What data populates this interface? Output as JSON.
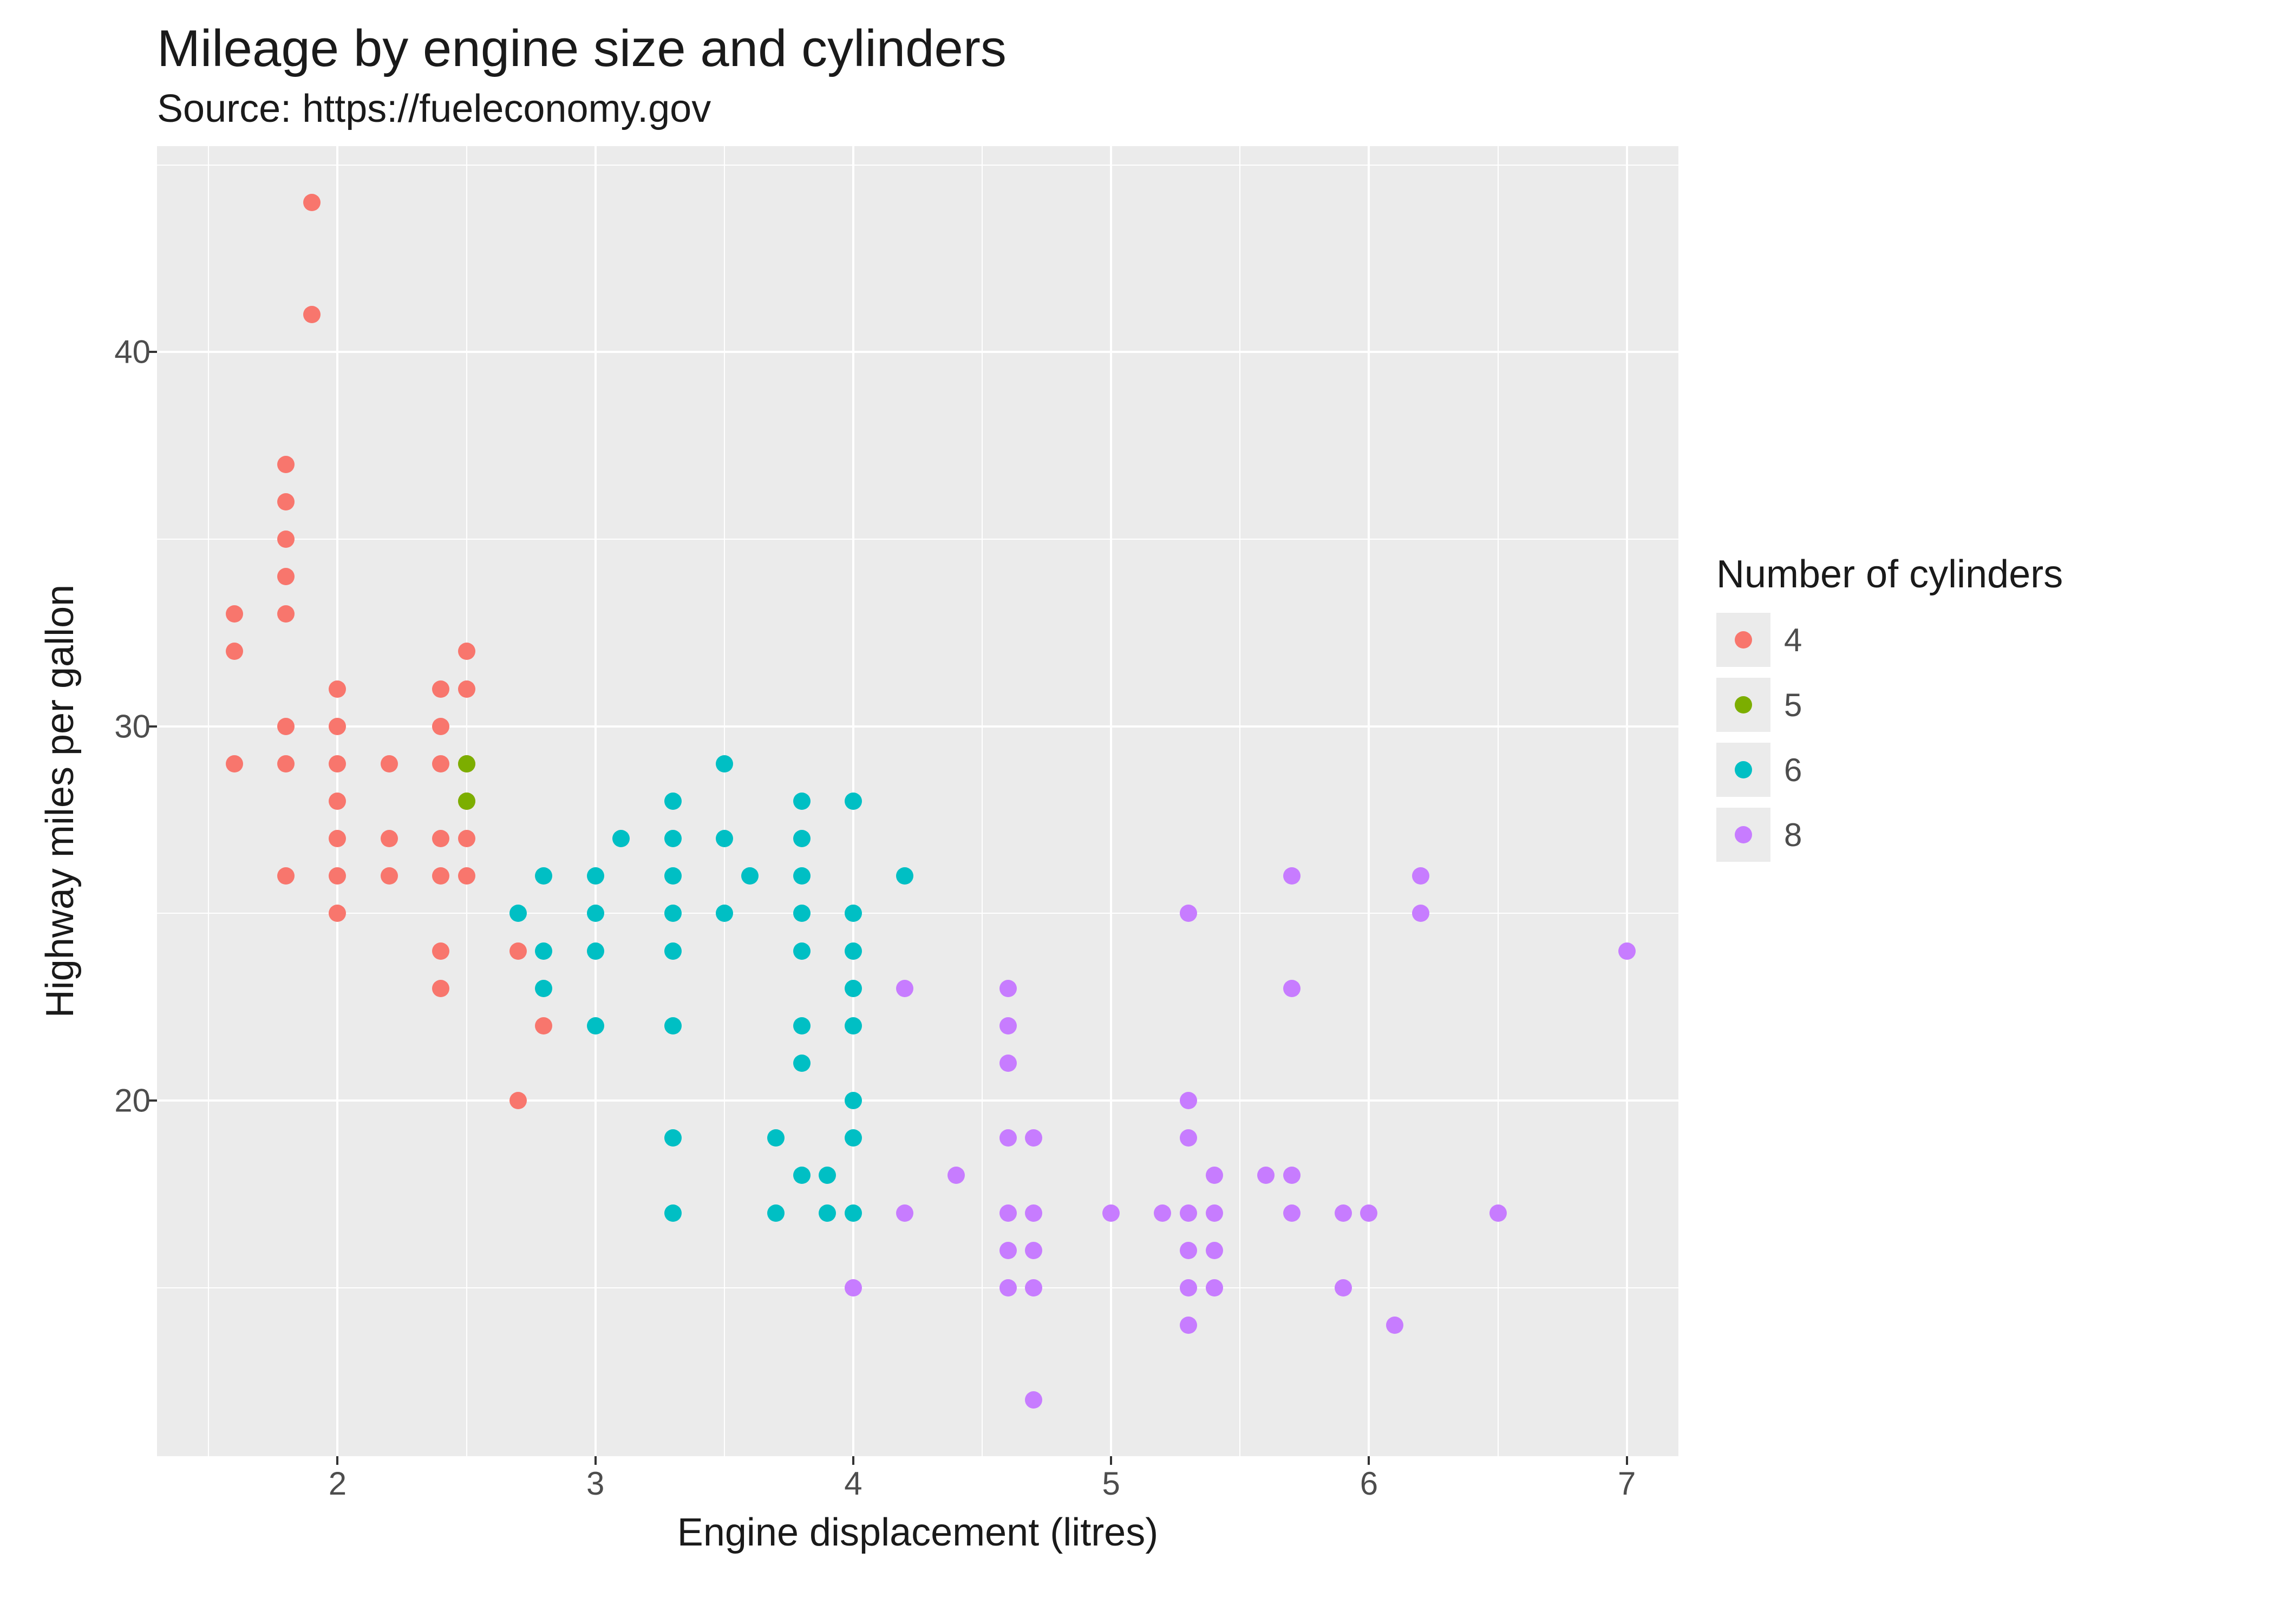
{
  "title": "Mileage by engine size and cylinders",
  "subtitle": "Source: https://fueleconomy.gov",
  "xlabel": "Engine displacement (litres)",
  "ylabel": "Highway miles per gallon",
  "legend_title": "Number of cylinders",
  "legend_items": [
    {
      "label": "4",
      "color": "#F8766D"
    },
    {
      "label": "5",
      "color": "#7CAE00"
    },
    {
      "label": "6",
      "color": "#00BFC4"
    },
    {
      "label": "8",
      "color": "#C77CFF"
    }
  ],
  "x_ticks": [
    2,
    3,
    4,
    5,
    6,
    7
  ],
  "y_ticks": [
    20,
    30,
    40
  ],
  "x_tick_labels": [
    "2",
    "3",
    "4",
    "5",
    "6",
    "7"
  ],
  "y_tick_labels": [
    "20",
    "30",
    "40"
  ],
  "chart_data": {
    "type": "scatter",
    "title": "Mileage by engine size and cylinders",
    "subtitle": "Source: https://fueleconomy.gov",
    "xlabel": "Engine displacement (litres)",
    "ylabel": "Highway miles per gallon",
    "xlim": [
      1.3,
      7.2
    ],
    "ylim": [
      10.5,
      45.5
    ],
    "legend_title": "Number of cylinders",
    "series": [
      {
        "name": "4",
        "color": "#F8766D",
        "points": [
          [
            1.6,
            29
          ],
          [
            1.6,
            32
          ],
          [
            1.6,
            33
          ],
          [
            1.8,
            26
          ],
          [
            1.8,
            29
          ],
          [
            1.8,
            30
          ],
          [
            1.8,
            33
          ],
          [
            1.8,
            34
          ],
          [
            1.8,
            35
          ],
          [
            1.8,
            36
          ],
          [
            1.8,
            37
          ],
          [
            1.9,
            41
          ],
          [
            1.9,
            44
          ],
          [
            2.0,
            25
          ],
          [
            2.0,
            26
          ],
          [
            2.0,
            27
          ],
          [
            2.0,
            28
          ],
          [
            2.0,
            29
          ],
          [
            2.0,
            30
          ],
          [
            2.0,
            31
          ],
          [
            2.2,
            26
          ],
          [
            2.2,
            27
          ],
          [
            2.2,
            29
          ],
          [
            2.4,
            23
          ],
          [
            2.4,
            24
          ],
          [
            2.4,
            26
          ],
          [
            2.4,
            27
          ],
          [
            2.4,
            29
          ],
          [
            2.4,
            30
          ],
          [
            2.4,
            31
          ],
          [
            2.5,
            26
          ],
          [
            2.5,
            27
          ],
          [
            2.5,
            28
          ],
          [
            2.5,
            29
          ],
          [
            2.5,
            31
          ],
          [
            2.5,
            32
          ],
          [
            2.7,
            24
          ],
          [
            2.8,
            22
          ],
          [
            2.7,
            20
          ]
        ]
      },
      {
        "name": "5",
        "color": "#7CAE00",
        "points": [
          [
            2.5,
            28
          ],
          [
            2.5,
            29
          ]
        ]
      },
      {
        "name": "6",
        "color": "#00BFC4",
        "points": [
          [
            2.7,
            25
          ],
          [
            2.8,
            23
          ],
          [
            2.8,
            24
          ],
          [
            2.8,
            26
          ],
          [
            3.0,
            22
          ],
          [
            3.0,
            24
          ],
          [
            3.0,
            25
          ],
          [
            3.0,
            26
          ],
          [
            3.1,
            27
          ],
          [
            3.3,
            17
          ],
          [
            3.3,
            19
          ],
          [
            3.3,
            22
          ],
          [
            3.3,
            24
          ],
          [
            3.3,
            25
          ],
          [
            3.3,
            26
          ],
          [
            3.3,
            27
          ],
          [
            3.3,
            28
          ],
          [
            3.5,
            25
          ],
          [
            3.5,
            27
          ],
          [
            3.5,
            29
          ],
          [
            3.6,
            26
          ],
          [
            3.7,
            17
          ],
          [
            3.7,
            19
          ],
          [
            3.8,
            18
          ],
          [
            3.8,
            21
          ],
          [
            3.8,
            22
          ],
          [
            3.8,
            24
          ],
          [
            3.8,
            25
          ],
          [
            3.8,
            26
          ],
          [
            3.8,
            27
          ],
          [
            3.8,
            28
          ],
          [
            3.9,
            17
          ],
          [
            3.9,
            18
          ],
          [
            4.0,
            17
          ],
          [
            4.0,
            19
          ],
          [
            4.0,
            20
          ],
          [
            4.0,
            22
          ],
          [
            4.0,
            23
          ],
          [
            4.0,
            24
          ],
          [
            4.0,
            25
          ],
          [
            4.2,
            26
          ],
          [
            4.0,
            28
          ]
        ]
      },
      {
        "name": "8",
        "color": "#C77CFF",
        "points": [
          [
            4.0,
            15
          ],
          [
            4.2,
            17
          ],
          [
            4.2,
            23
          ],
          [
            4.4,
            18
          ],
          [
            4.6,
            15
          ],
          [
            4.6,
            16
          ],
          [
            4.6,
            17
          ],
          [
            4.6,
            19
          ],
          [
            4.6,
            21
          ],
          [
            4.6,
            22
          ],
          [
            4.6,
            23
          ],
          [
            4.7,
            12
          ],
          [
            4.7,
            15
          ],
          [
            4.7,
            16
          ],
          [
            4.7,
            17
          ],
          [
            4.7,
            19
          ],
          [
            5.0,
            17
          ],
          [
            5.2,
            17
          ],
          [
            5.3,
            14
          ],
          [
            5.3,
            15
          ],
          [
            5.3,
            16
          ],
          [
            5.3,
            17
          ],
          [
            5.3,
            19
          ],
          [
            5.3,
            20
          ],
          [
            5.3,
            25
          ],
          [
            5.4,
            15
          ],
          [
            5.4,
            16
          ],
          [
            5.4,
            17
          ],
          [
            5.4,
            18
          ],
          [
            5.6,
            18
          ],
          [
            5.7,
            17
          ],
          [
            5.7,
            18
          ],
          [
            5.7,
            23
          ],
          [
            5.7,
            26
          ],
          [
            5.9,
            15
          ],
          [
            5.9,
            17
          ],
          [
            6.0,
            17
          ],
          [
            6.1,
            14
          ],
          [
            6.2,
            25
          ],
          [
            6.2,
            26
          ],
          [
            6.5,
            17
          ],
          [
            7.0,
            24
          ]
        ]
      }
    ]
  }
}
